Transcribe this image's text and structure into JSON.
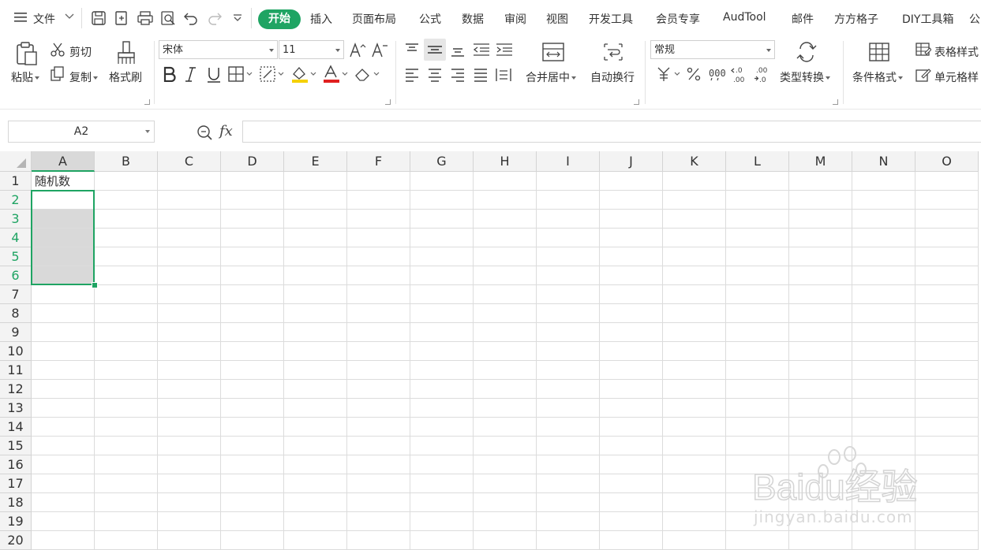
{
  "menu": {
    "file": "文件",
    "tabs": [
      "开始",
      "插入",
      "页面布局",
      "公式",
      "数据",
      "审阅",
      "视图",
      "开发工具",
      "会员专享",
      "AudTool",
      "邮件",
      "方方格子",
      "DIY工具箱",
      "公"
    ],
    "active_tab": "开始"
  },
  "ribbon": {
    "paste": "粘贴",
    "cut": "剪切",
    "copy": "复制",
    "format_painter": "格式刷",
    "font_name": "宋体",
    "font_size": "11",
    "merge_center": "合并居中",
    "wrap_text": "自动换行",
    "number_format": "常规",
    "convert_type": "类型转换",
    "conditional_format": "条件格式",
    "table_style": "表格样式",
    "cell_style": "单元格样"
  },
  "formula_bar": {
    "name_box": "A2",
    "fx": "fx",
    "value": ""
  },
  "sheet": {
    "columns": [
      "A",
      "B",
      "C",
      "D",
      "E",
      "F",
      "G",
      "H",
      "I",
      "J",
      "K",
      "L",
      "M",
      "N",
      "O"
    ],
    "rows": [
      "1",
      "2",
      "3",
      "4",
      "5",
      "6",
      "7",
      "8",
      "9",
      "10",
      "11",
      "12",
      "13",
      "14",
      "15",
      "16",
      "17",
      "18",
      "19",
      "20"
    ],
    "cells": {
      "A1": "随机数"
    },
    "active_cell": "A2",
    "selection": "A2:A6"
  },
  "watermark": {
    "brand": "Baidu经验",
    "url": "jingyan.baidu.com"
  },
  "colors": {
    "accent": "#1fa463",
    "selection": "#1fa463",
    "selected_fill": "#d9d9d9"
  }
}
